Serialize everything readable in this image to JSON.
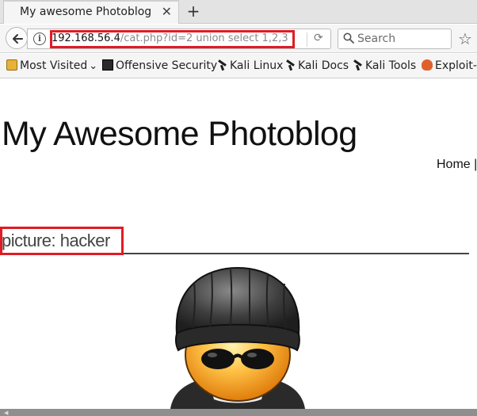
{
  "tab": {
    "title": "My awesome Photoblog",
    "close_glyph": "✕"
  },
  "new_tab_glyph": "+",
  "url": {
    "host": "192.168.56.4",
    "path": "/cat.php?id=2 union select 1,2,3"
  },
  "search": {
    "placeholder": "Search"
  },
  "bookmarks": [
    {
      "label": "Most Visited",
      "icon": "folder-icon",
      "chevron": "⌄"
    },
    {
      "label": "Offensive Security",
      "icon": "offsec-icon"
    },
    {
      "label": "Kali Linux",
      "icon": "kali-dragon-icon"
    },
    {
      "label": "Kali Docs",
      "icon": "kali-dragon-icon"
    },
    {
      "label": "Kali Tools",
      "icon": "kali-dragon-icon"
    },
    {
      "label": "Exploit-D",
      "icon": "exploit-db-icon"
    }
  ],
  "page": {
    "title": "My Awesome Photoblog",
    "nav": "Home |",
    "picture_heading": "picture: hacker"
  },
  "colors": {
    "highlight": "#e01b24"
  }
}
